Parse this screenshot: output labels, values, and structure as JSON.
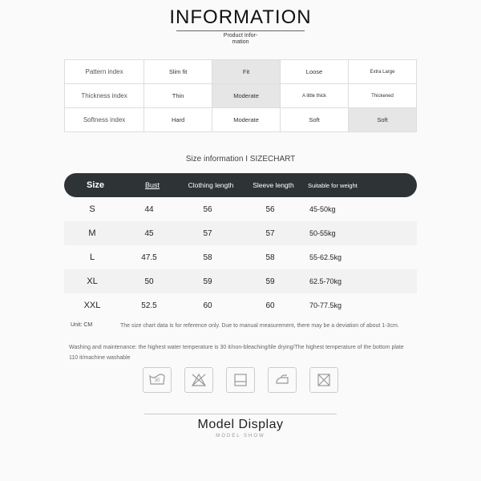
{
  "header": {
    "title": "INFORMATION",
    "subtitle_line1": "Product Infor-",
    "subtitle_line2": "mation"
  },
  "attributes": [
    {
      "label": "Pattern index",
      "options": [
        "Slim fit",
        "Fit",
        "Loose",
        "Extra Large"
      ],
      "selected": 1
    },
    {
      "label": "Thickness index",
      "options": [
        "Thin",
        "Moderate",
        "A little thick",
        "Thickened"
      ],
      "selected": 1
    },
    {
      "label": "Softness index",
      "options": [
        "Hard",
        "Moderate",
        "Soft",
        "Soft"
      ],
      "selected": 3
    }
  ],
  "size_section_title": "Size information I SIZECHART",
  "chart_data": {
    "type": "table",
    "title": "Size information I SIZECHART",
    "columns": [
      "Size",
      "Bust",
      "Clothing length",
      "Sleeve length",
      "Suitable for weight"
    ],
    "rows": [
      [
        "S",
        44,
        56,
        56,
        "45-50kg"
      ],
      [
        "M",
        45,
        57,
        57,
        "50-55kg"
      ],
      [
        "L",
        47.5,
        58,
        58,
        "55-62.5kg"
      ],
      [
        "XL",
        50,
        59,
        59,
        "62.5-70kg"
      ],
      [
        "XXL",
        52.5,
        60,
        60,
        "70-77.5kg"
      ]
    ],
    "unit": "CM"
  },
  "size_headers": {
    "c1": "Size",
    "c2": "Bust",
    "c3": "Clothing length",
    "c4": "Sleeve length",
    "c5": "Suitable for weight"
  },
  "size_rows": [
    {
      "c1": "S",
      "c2": "44",
      "c3": "56",
      "c4": "56",
      "c5": "45-50kg"
    },
    {
      "c1": "M",
      "c2": "45",
      "c3": "57",
      "c4": "57",
      "c5": "50-55kg"
    },
    {
      "c1": "L",
      "c2": "47.5",
      "c3": "58",
      "c4": "58",
      "c5": "55-62.5kg"
    },
    {
      "c1": "XL",
      "c2": "50",
      "c3": "59",
      "c4": "59",
      "c5": "62.5-70kg"
    },
    {
      "c1": "XXL",
      "c2": "52.5",
      "c3": "60",
      "c4": "60",
      "c5": "70-77.5kg"
    }
  ],
  "unit": {
    "label": "Unit: CM",
    "note": "The size chart data is for reference only. Due to manual measurement, there may be a deviation of about 1-3cm."
  },
  "care": {
    "note": "Washing and maintenance: the highest water temperature is 30 it/non-bleaching/tile drying/The highest temperature of the bottom plate",
    "sub": "110 it/machine washable",
    "icons": [
      "wash-30-icon",
      "no-bleach-icon",
      "tumble-dry-icon",
      "iron-icon",
      "no-dryclean-icon"
    ]
  },
  "model": {
    "title": "Model Display",
    "sub": "MODEL SHOW"
  }
}
